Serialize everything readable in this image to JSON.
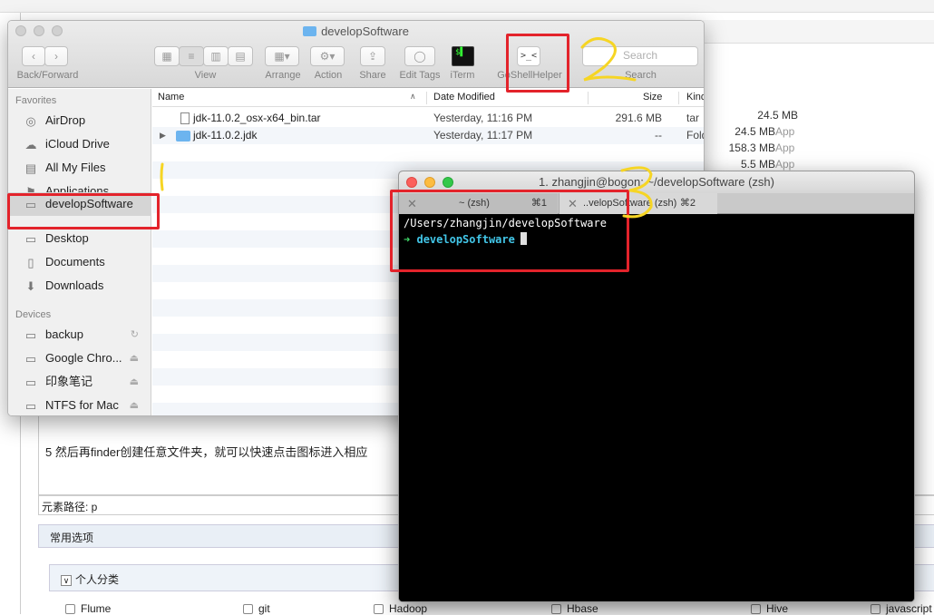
{
  "background": {
    "table_sizes": [
      "24.5 MB",
      "158.3 MB",
      "5.5 MB"
    ],
    "table_kind": "App",
    "editor_sentence": "5 然后再finder创建任意文件夹，就可以快速点击图标进入相应",
    "element_path": "元素路径: p",
    "common_options": "常用选项",
    "personal_category": "个人分类",
    "checkboxes": [
      "Flume",
      "git",
      "Hadoop",
      "Hbase",
      "Hive",
      "javascript"
    ]
  },
  "finder": {
    "title": "developSoftware",
    "toolbar": {
      "back_forward": "Back/Forward",
      "view": "View",
      "arrange": "Arrange",
      "action": "Action",
      "share": "Share",
      "edit_tags": "Edit Tags",
      "iterm": "iTerm",
      "goshell": "GoShellHelper",
      "search_placeholder": "Search",
      "search_label": "Search"
    },
    "sidebar": {
      "favorites_header": "Favorites",
      "favorites": [
        "AirDrop",
        "iCloud Drive",
        "All My Files",
        "Applications",
        "developSoftware",
        "Desktop",
        "Documents",
        "Downloads"
      ],
      "devices_header": "Devices",
      "devices": [
        "backup",
        "Google Chro...",
        "印象笔记",
        "NTFS for Mac"
      ]
    },
    "columns": {
      "name": "Name",
      "date": "Date Modified",
      "size": "Size",
      "kind": "Kind"
    },
    "files": [
      {
        "name": "jdk-11.0.2_osx-x64_bin.tar",
        "date": "Yesterday, 11:16 PM",
        "size": "291.6 MB",
        "kind": "tar a"
      },
      {
        "name": "jdk-11.0.2.jdk",
        "date": "Yesterday, 11:17 PM",
        "size": "--",
        "kind": "Fold"
      }
    ]
  },
  "terminal": {
    "title": "1. zhangjin@bogon: ~/developSoftware (zsh)",
    "tabs": [
      {
        "label": "~ (zsh)",
        "shortcut": "⌘1"
      },
      {
        "label": "..velopSoftware (zsh)",
        "shortcut": "⌘2"
      }
    ],
    "line1": "/Users/zhangjin/developSoftware",
    "prompt_arrow": "➜",
    "prompt_dir": "developSoftware"
  },
  "annotations": [
    "1",
    "2",
    "3"
  ],
  "colors": {
    "annotation_red": "#e3232b",
    "annotation_yellow": "#f6d524",
    "prompt_green": "#41d86a",
    "prompt_cyan": "#42c6e8"
  }
}
